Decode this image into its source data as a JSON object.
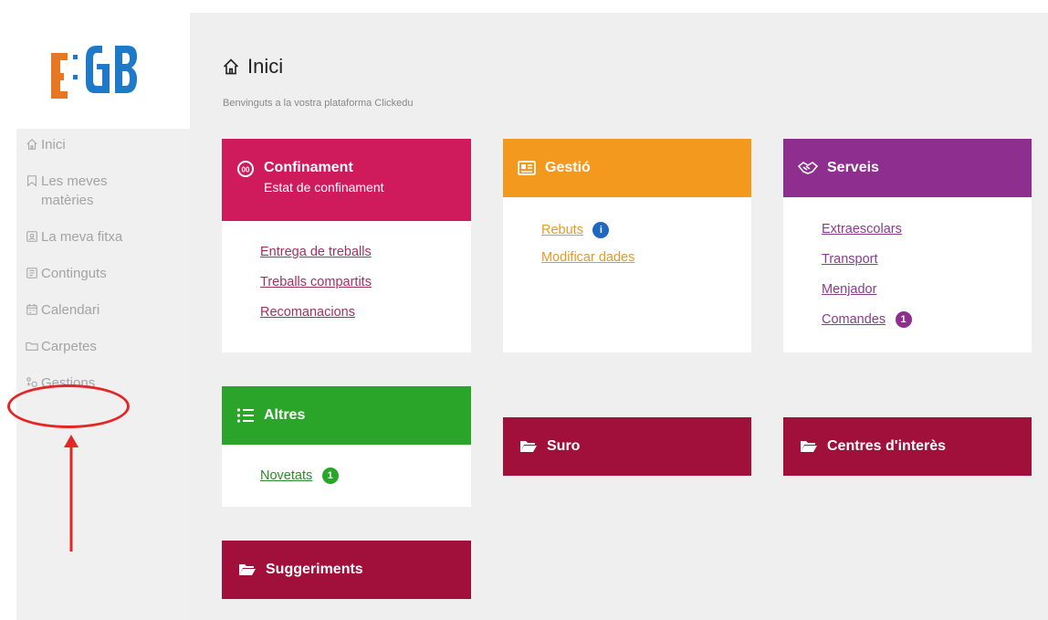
{
  "logo": {
    "text": "EGB"
  },
  "sidebar": {
    "items": [
      {
        "label": "Inici",
        "icon": "home-icon"
      },
      {
        "label": "Les meves matèries",
        "icon": "bookmark-icon"
      },
      {
        "label": "La meva fitxa",
        "icon": "profile-card-icon"
      },
      {
        "label": "Continguts",
        "icon": "content-icon"
      },
      {
        "label": "Calendari",
        "icon": "calendar-icon"
      },
      {
        "label": "Carpetes",
        "icon": "folder-icon"
      },
      {
        "label": "Gestions",
        "icon": "handshake-icon"
      }
    ]
  },
  "header": {
    "title": "Inici",
    "subtitle": "Benvinguts a la vostra plataforma Clickedu"
  },
  "cards": {
    "confinament": {
      "title": "Confinament",
      "subtitle": "Estat de confinament",
      "color": "#cf1a5c",
      "link_color": "#a33063",
      "links": [
        "Entrega de treballs",
        "Treballs compartits",
        "Recomanacions"
      ]
    },
    "gestio": {
      "title": "Gestió",
      "color": "#f39a1e",
      "link_color": "#e49a2a",
      "links": [
        {
          "label": "Rebuts",
          "badge": "i"
        },
        {
          "label": "Modificar dades"
        }
      ]
    },
    "serveis": {
      "title": "Serveis",
      "color": "#8e2e8f",
      "link_color": "#8a3b8f",
      "links": [
        {
          "label": "Extraescolars"
        },
        {
          "label": "Transport"
        },
        {
          "label": "Menjador"
        },
        {
          "label": "Comandes",
          "badge": "1"
        }
      ]
    },
    "altres": {
      "title": "Altres",
      "color": "#2aa52a",
      "link_color": "#2e8b2e",
      "links": [
        {
          "label": "Novetats",
          "badge": "1"
        }
      ]
    },
    "suro": {
      "title": "Suro",
      "color": "#a0103a"
    },
    "centres": {
      "title": "Centres d'interès",
      "color": "#a0103a"
    },
    "suggeriments": {
      "title": "Suggeriments",
      "color": "#a0103a"
    }
  }
}
